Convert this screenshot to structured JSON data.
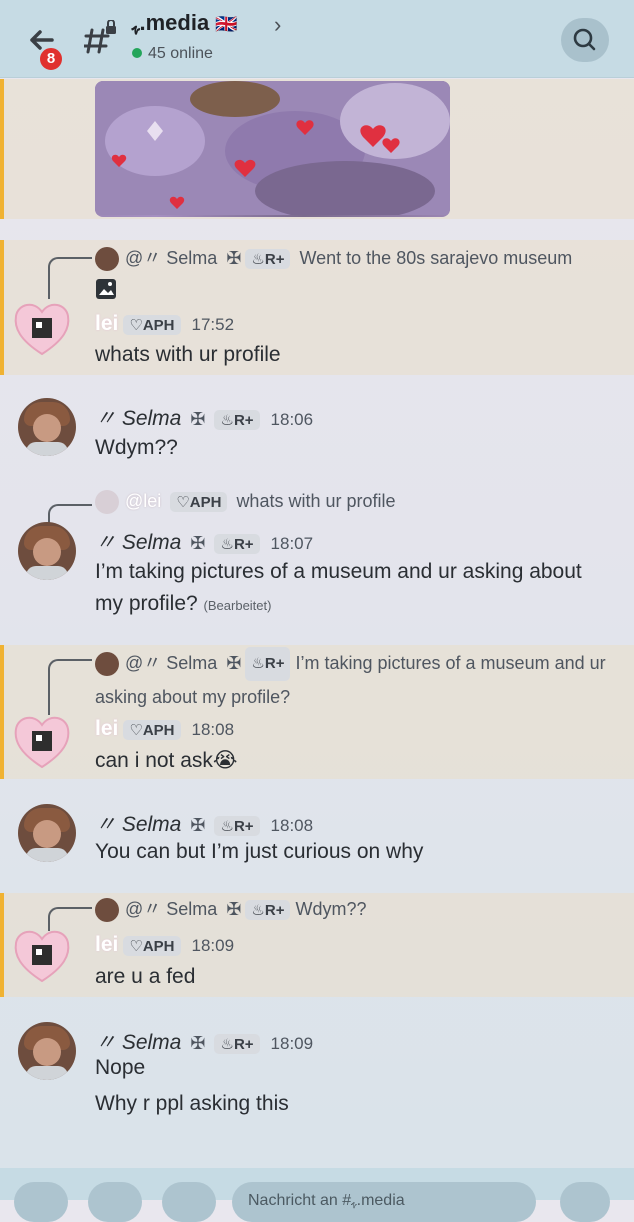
{
  "header": {
    "back_badge": "8",
    "channel_name": "ﮩ.media",
    "channel_flag": "🇬🇧",
    "online": "45 online"
  },
  "messages": [
    {
      "reply_user": "@〃 Selma",
      "reply_cross": "✠",
      "reply_tag": "R+",
      "reply_text": "Went to the 80s sarajevo museum",
      "author": "lei",
      "tag": "APH",
      "time": "17:52",
      "text": "whats with ur profile"
    },
    {
      "author": "〃 Selma",
      "cross": "✠",
      "tag": "R+",
      "time": "18:06",
      "text": "Wdym??"
    },
    {
      "reply_user": "@lei",
      "reply_tag": "APH",
      "reply_text": "whats with ur profile",
      "author": "〃 Selma",
      "cross": "✠",
      "tag": "R+",
      "time": "18:07",
      "text": "I’m taking pictures of a museum and ur asking about my profile?",
      "edited": "(Bearbeitet)"
    },
    {
      "reply_user": "@〃 Selma",
      "reply_cross": "✠",
      "reply_tag": "R+",
      "reply_text": "I’m taking pictures of a museum and ur asking about my profile?",
      "author": "lei",
      "tag": "APH",
      "time": "18:08",
      "text": "can i not ask😭"
    },
    {
      "author": "〃 Selma",
      "cross": "✠",
      "tag": "R+",
      "time": "18:08",
      "text": "You can but I’m just curious on why"
    },
    {
      "reply_user": "@〃 Selma",
      "reply_cross": "✠",
      "reply_tag": "R+",
      "reply_text": "Wdym??",
      "author": "lei",
      "tag": "APH",
      "time": "18:09",
      "text": "are u a fed"
    },
    {
      "author": "〃 Selma",
      "cross": "✠",
      "tag": "R+",
      "time": "18:09",
      "text": "Nope",
      "text2": "Why r ppl asking this"
    }
  ],
  "composer": {
    "placeholder": "Nachricht an #ﮩ.media"
  },
  "colors": {
    "accent_bar": "#f0b232",
    "badge": "#e0312e",
    "online_dot": "#23a55a",
    "topbar": "#c6dbe4"
  }
}
